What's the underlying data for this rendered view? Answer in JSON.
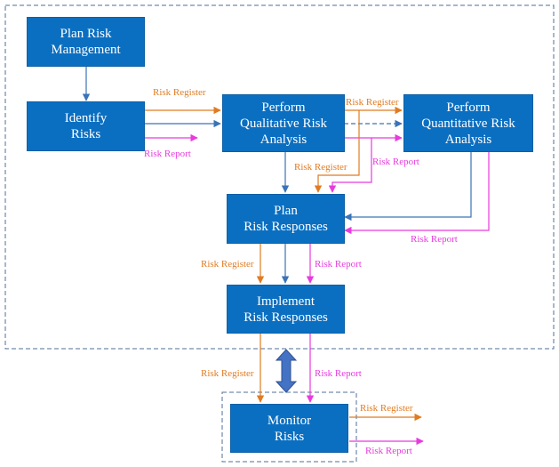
{
  "colors": {
    "process_fill": "#0b6fc1",
    "process_text": "#ffffff",
    "flow_arrow": "#3a73b8",
    "risk_register": "#e07b22",
    "risk_report": "#e83adf",
    "boundary": "#4f6f9a",
    "double_arrow": "#4472c4"
  },
  "nodes": {
    "plan_risk_management": {
      "line1": "Plan Risk",
      "line2": "Management"
    },
    "identify_risks": {
      "line1": "Identify",
      "line2": "Risks"
    },
    "qualitative": {
      "line1": "Perform",
      "line2": "Qualitative Risk",
      "line3": "Analysis"
    },
    "quantitative": {
      "line1": "Perform",
      "line2": "Quantitative Risk",
      "line3": "Analysis"
    },
    "plan_responses": {
      "line1": "Plan",
      "line2": "Risk Responses"
    },
    "implement_responses": {
      "line1": "Implement",
      "line2": "Risk Responses"
    },
    "monitor_risks": {
      "line1": "Monitor",
      "line2": "Risks"
    }
  },
  "labels": {
    "identify_to_qual_register": "Risk Register",
    "identify_report": "Risk Report",
    "qual_to_quant_register": "Risk Register",
    "qual_to_plan_register": "Risk Register",
    "qual_to_plan_report": "Risk Report",
    "quant_to_plan_report": "Risk Report",
    "plan_to_impl_register": "Risk Register",
    "plan_to_impl_report": "Risk Report",
    "impl_to_monitor_register": "Risk Register",
    "impl_to_monitor_report": "Risk Report",
    "monitor_out_register": "Risk Register",
    "monitor_out_report": "Risk Report"
  }
}
